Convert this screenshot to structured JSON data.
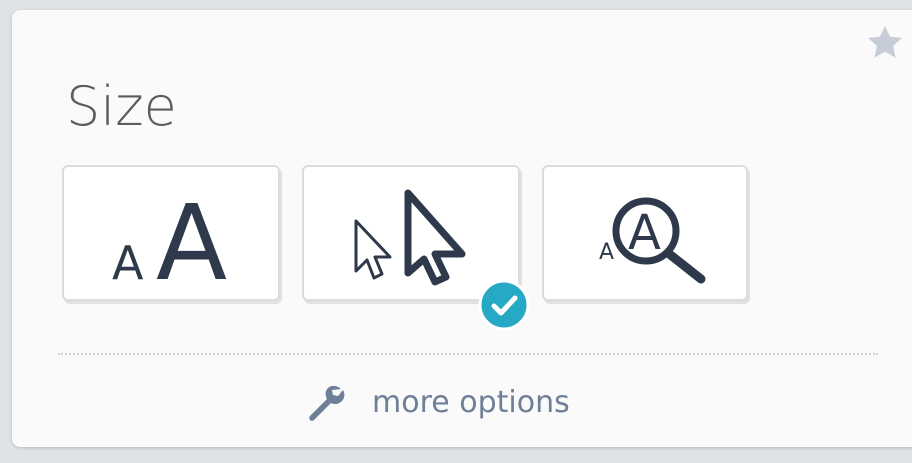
{
  "panel": {
    "title": "Size",
    "options": [
      {
        "id": "text-size",
        "glyph_small": "A",
        "glyph_large": "A",
        "selected": false
      },
      {
        "id": "cursor-size",
        "selected": true
      },
      {
        "id": "magnifier",
        "glyph_small": "A",
        "glyph_large": "A",
        "selected": false
      }
    ],
    "more_options_label": "more options"
  },
  "icons": {
    "favorite": "star-icon",
    "selected": "check-circle-icon",
    "settings": "wrench-icon"
  },
  "colors": {
    "accent": "#26a9c5",
    "icon_dark": "#2e3a4c",
    "link": "#6f7f97",
    "star": "#c7cdd6"
  }
}
